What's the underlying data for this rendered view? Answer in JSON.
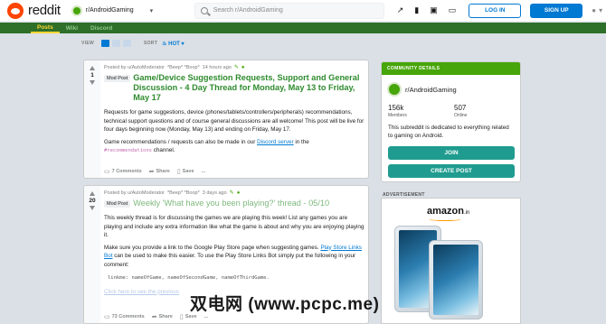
{
  "header": {
    "logo_text": "reddit",
    "subreddit": "r/AndroidGaming",
    "search_placeholder": "Search r/AndroidGaming",
    "login": "LOG IN",
    "signup": "SIGN UP"
  },
  "subnav": {
    "tabs": [
      "Posts",
      "Wiki",
      "Discord"
    ]
  },
  "sortbar": {
    "view_label": "VIEW",
    "sort_label": "SORT",
    "sort_value": "HOT"
  },
  "posts": [
    {
      "score": "1",
      "meta": "Posted by u/AutoModerator",
      "beep": "*Beep* *Boop*",
      "time": "14 hours ago",
      "flair": "Mod Post",
      "title": "Game/Device Suggestion Requests, Support and General Discussion - 4 Day Thread for Monday, May 13 to Friday, May 17",
      "para1": "Requests for game suggestions, device (phones/tablets/controllers/peripherals) recommendations, technical support questions and of course general discussions are all welcome! This post will be live for four days beginning now (Monday, May 13) and ending on Friday, May 17.",
      "para2_a": "Game recommendations / requests can also be made in our ",
      "para2_link": "Discord server",
      "para2_b": " in the",
      "para2_code": "#recommendations",
      "para2_c": " channel.",
      "comments": "7 Comments",
      "share": "Share",
      "save": "Save",
      "more": "..."
    },
    {
      "score": "20",
      "meta": "Posted by u/AutoModerator",
      "beep": "*Beep* *Boop*",
      "time": "3 days ago",
      "flair": "Mod Post",
      "title": "Weekly 'What have you been playing?' thread - 05/10",
      "para1": "This weekly thread is for discussing the games we are playing this week! List any games you are playing and include any extra information like what the game is about and why you are enjoying playing it.",
      "para2_a": "Make sure you provide a link to the Google Play Store page when suggesting games. ",
      "para2_link": "Play Store Links Bot",
      "para2_b": " can be used to make this easier. To use the Play Store Links Bot simply put the following in your comment:",
      "code": "linkme: nameOfGame, nameOfSecondGame, nameOfThirdGame.",
      "faded_link": "Click here to see the previous",
      "comments": "73 Comments",
      "share": "Share",
      "save": "Save",
      "more": "..."
    }
  ],
  "sidebar": {
    "header": "COMMUNITY DETAILS",
    "name": "r/AndroidGaming",
    "members_num": "156k",
    "members_lbl": "Members",
    "online_num": "507",
    "online_lbl": "Online",
    "description": "This subreddit is dedicated to everything related to gaming on Android.",
    "join": "JOIN",
    "create_post": "CREATE POST"
  },
  "ad": {
    "label": "ADVERTISEMENT",
    "brand": "amazon",
    "brand_suffix": ".in"
  },
  "watermark": "双电网 (www.pcpc.me)",
  "colors": {
    "accent": "#0079d3",
    "community": "#46a508",
    "button": "#1f9c8f",
    "nav": "#2e6f2a"
  }
}
